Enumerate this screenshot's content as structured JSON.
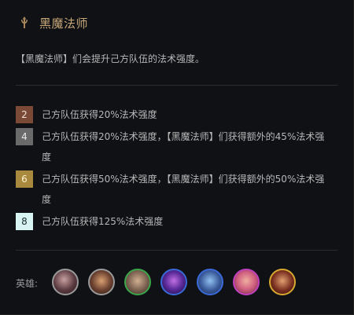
{
  "trait": {
    "name": "黑魔法师",
    "icon": "staff-icon",
    "description": "【黑魔法师】们会提升己方队伍的法术强度。"
  },
  "tiers": [
    {
      "count": "2",
      "text": "己方队伍获得20%法术强度",
      "color": "#7a4a36",
      "text_color": "#f0e2d6"
    },
    {
      "count": "4",
      "text": "己方队伍获得20%法术强度，【黑魔法师】们获得额外的45%法术强度",
      "color": "#6a6a6a",
      "text_color": "#e8e8e8"
    },
    {
      "count": "6",
      "text": "己方队伍获得50%法术强度，【黑魔法师】们获得额外的50%法术强度",
      "color": "#a8893e",
      "text_color": "#fff2cc"
    },
    {
      "count": "8",
      "text": "己方队伍获得125%法术强度",
      "color": "#d8f4f2",
      "text_color": "#1a2a2a"
    }
  ],
  "heroes_label": "英雄:",
  "champions": [
    {
      "name": "champion-1",
      "border": "#9a9a9a",
      "bg": "#5a3a40"
    },
    {
      "name": "champion-2",
      "border": "#9a9a9a",
      "bg": "#6a4030"
    },
    {
      "name": "champion-3",
      "border": "#3aa84a",
      "bg": "#7a6050"
    },
    {
      "name": "champion-4",
      "border": "#3a6ad8",
      "bg": "#3a1a6a"
    },
    {
      "name": "champion-5",
      "border": "#3a6ad8",
      "bg": "#3a5a9a"
    },
    {
      "name": "champion-6",
      "border": "#c040c0",
      "bg": "#d06080"
    },
    {
      "name": "champion-7",
      "border": "#d8a830",
      "bg": "#7a3020"
    }
  ]
}
